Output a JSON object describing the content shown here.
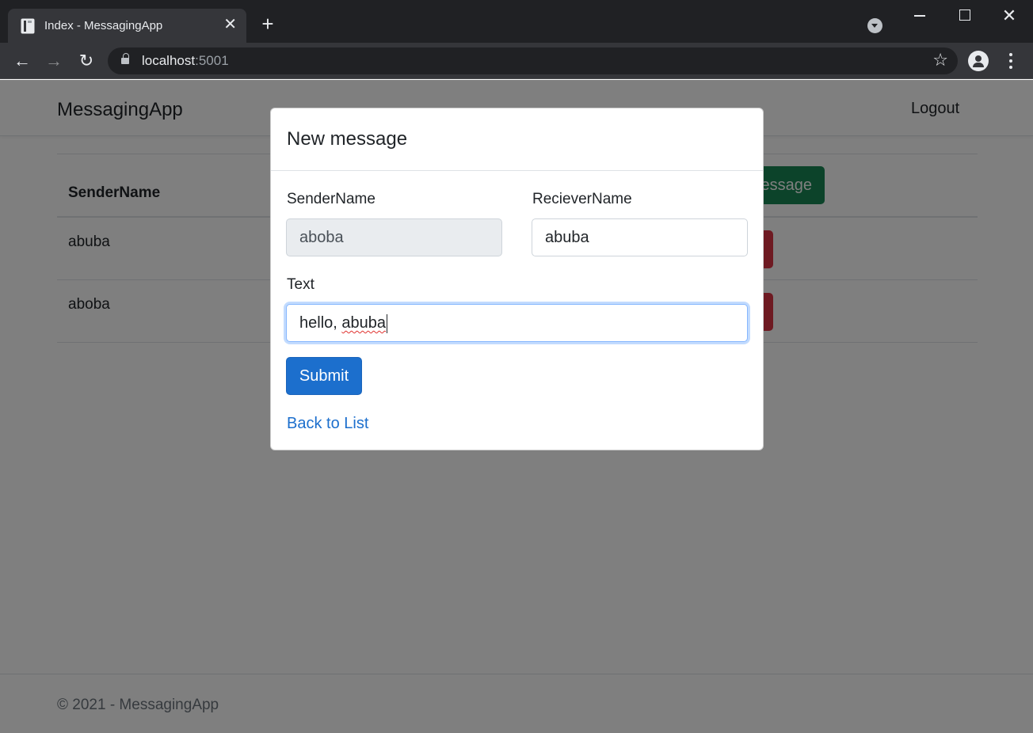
{
  "browser": {
    "tab_title": "Index - MessagingApp",
    "url_host": "localhost",
    "url_port": ":5001"
  },
  "navbar": {
    "brand": "MessagingApp",
    "logout": "Logout"
  },
  "table": {
    "header": "SenderName",
    "new_message_label": "essage",
    "rows": [
      {
        "sender": "abuba"
      },
      {
        "sender": "aboba"
      }
    ]
  },
  "footer": {
    "text": "© 2021 - MessagingApp"
  },
  "modal": {
    "title": "New message",
    "sender_label": "SenderName",
    "sender_value": "aboba",
    "receiver_label": "RecieverName",
    "receiver_value": "abuba",
    "text_label": "Text",
    "text_value_prefix": "hello, ",
    "text_value_word": "abuba",
    "submit_label": "Submit",
    "back_link": "Back to List"
  },
  "colors": {
    "primary": "#1c6fcd",
    "success": "#198754",
    "danger": "#dc3545"
  }
}
